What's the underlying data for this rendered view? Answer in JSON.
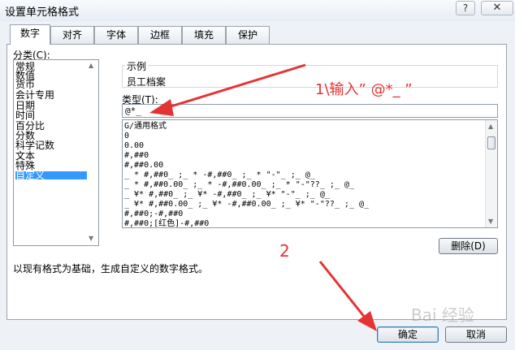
{
  "window": {
    "title": "设置单元格格式",
    "help_label": "?",
    "close_label": "✕"
  },
  "tabs": [
    {
      "label": "数字",
      "active": true
    },
    {
      "label": "对齐"
    },
    {
      "label": "字体"
    },
    {
      "label": "边框"
    },
    {
      "label": "填充"
    },
    {
      "label": "保护"
    }
  ],
  "category": {
    "label": "分类(C):",
    "items": [
      "常规",
      "数值",
      "货币",
      "会计专用",
      "日期",
      "时间",
      "百分比",
      "分数",
      "科学记数",
      "文本",
      "特殊",
      "自定义"
    ],
    "selected": "自定义"
  },
  "sample": {
    "label": "示例",
    "value": "员工档案"
  },
  "type": {
    "label": "类型(T):",
    "value": "@*_"
  },
  "formats": [
    "G/通用格式",
    "0",
    "0.00",
    "#,##0",
    "#,##0.00",
    "_ * #,##0_ ;_ * -#,##0_ ;_ * \"-\"_ ;_ @_",
    "_ * #,##0.00_ ;_ * -#,##0.00_ ;_ * \"-\"??_ ;_ @_",
    "_ ¥* #,##0_ ;_ ¥* -#,##0_ ;_ ¥* \"-\"_ ;_ @_",
    "_ ¥* #,##0.00_ ;_ ¥* -#,##0.00_ ;_ ¥* \"-\"??_ ;_ @_",
    "#,##0;-#,##0",
    "#,##0;[红色]-#,##0"
  ],
  "buttons": {
    "delete": "删除(D)",
    "ok": "确定",
    "cancel": "取消"
  },
  "description": "以现有格式为基础，生成自定义的数字格式。",
  "annotations": {
    "step1": "1\\输入” @*_ ”",
    "step2": "2",
    "color": "#e53333"
  },
  "watermark": "Bai 经验"
}
